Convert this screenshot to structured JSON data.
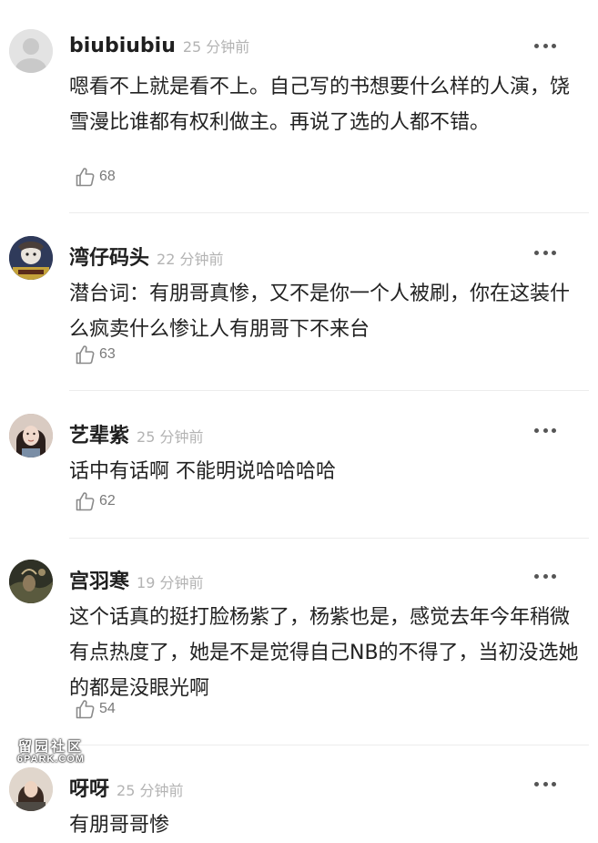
{
  "comments": [
    {
      "username": "biubiubiu",
      "time": "25 分钟前",
      "text": "嗯看不上就是看不上。自己写的书想要什么样的人演，饶雪漫比谁都有权利做主。再说了选的人都不错。",
      "likes": "68",
      "avatar": "default-gray-avatar"
    },
    {
      "username": "湾仔码头",
      "time": "22 分钟前",
      "text": "潜台词：有朋哥真惨，又不是你一个人被刷，你在这装什么疯卖什么惨让人有朋哥下不来台",
      "likes": "63",
      "avatar": "cartoon-avatar"
    },
    {
      "username": "艺辈紫",
      "time": "25 分钟前",
      "text": "话中有话啊 不能明说哈哈哈哈",
      "likes": "62",
      "avatar": "woman-photo-avatar"
    },
    {
      "username": "宫羽寒",
      "time": "19 分钟前",
      "text": "这个话真的挺打脸杨紫了，杨紫也是，感觉去年今年稍微有点热度了，她是不是觉得自己NB的不得了，当初没选她的都是没眼光啊",
      "likes": "54",
      "avatar": "dark-photo-avatar"
    },
    {
      "username": "呀呀",
      "time": "25 分钟前",
      "text": "有朋哥哥惨",
      "likes": "",
      "avatar": "girl-photo-avatar"
    }
  ],
  "watermark": {
    "cn": "留园社区",
    "en": "6PARK.COM"
  }
}
